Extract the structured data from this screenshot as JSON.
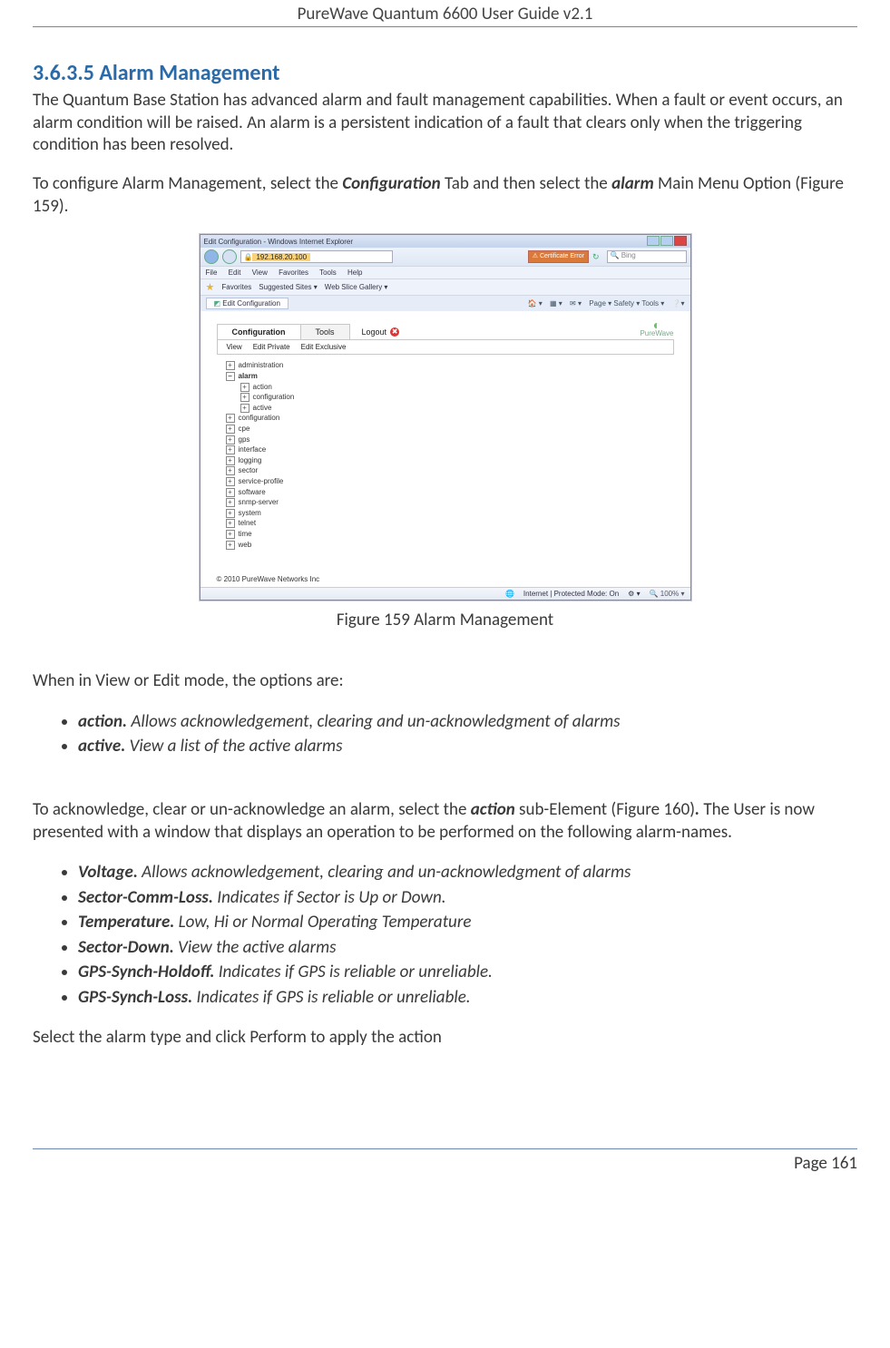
{
  "doc": {
    "header": "PureWave Quantum 6600 User Guide v2.1",
    "page_number": "Page 161"
  },
  "section": {
    "number": "3.6.3.5",
    "title": "Alarm Management"
  },
  "paragraphs": {
    "p1": "The Quantum Base Station has advanced alarm and fault management capabilities.  When a fault or event occurs, an alarm condition will be raised. An alarm is a persistent indication of a fault that clears only when the triggering condition has been resolved.",
    "p2_a": "To configure Alarm Management, select the ",
    "p2_conf": "Configuration",
    "p2_b": " Tab and then select the ",
    "p2_alarm": "alarm",
    "p2_c": " Main Menu Option (Figure 159).",
    "fig_caption": "Figure 159 Alarm Management",
    "p3": "When in View or Edit mode, the options are:",
    "p4_a": "To acknowledge, clear or un-acknowledge an alarm, select the ",
    "p4_action": "action",
    "p4_b": " sub-Element (Figure 160)",
    "p4_dot": ".",
    "p4_c": " The User is now presented with a window that displays an operation to be performed on the following alarm-names.",
    "p5": "Select the alarm type and click Perform to apply the action"
  },
  "list1": [
    {
      "term": "action.",
      "desc": "  Allows acknowledgement, clearing and un-acknowledgment of alarms"
    },
    {
      "term": "active.",
      "desc": "  View a list of the active alarms"
    }
  ],
  "list2": [
    {
      "term": "Voltage.",
      "desc": "  Allows acknowledgement, clearing and un-acknowledgment of alarms"
    },
    {
      "term": "Sector-Comm-Loss.",
      "desc": "  Indicates if Sector is Up or Down."
    },
    {
      "term": "Temperature.",
      "desc": "  Low, Hi or Normal Operating Temperature"
    },
    {
      "term": "Sector-Down.",
      "desc": "  View the active alarms"
    },
    {
      "term": "GPS-Synch-Holdoff.",
      "desc": "  Indicates if GPS is reliable or unreliable."
    },
    {
      "term": "GPS-Synch-Loss.",
      "desc": "  Indicates if GPS is reliable or unreliable."
    }
  ],
  "screenshot": {
    "window_title": "Edit Configuration - Windows Internet Explorer",
    "url_ip": "192.168.20.100",
    "cert_label": "Certificate Error",
    "search_placeholder": "Bing",
    "menubar": [
      "File",
      "Edit",
      "View",
      "Favorites",
      "Tools",
      "Help"
    ],
    "favbar_label": "Favorites",
    "favbar_suggested": "Suggested Sites ▾",
    "favbar_slice": "Web Slice Gallery ▾",
    "page_tab": "Edit Configuration",
    "toolbar_items": "Page ▾  Safety ▾  Tools ▾",
    "app_tabs": {
      "configuration": "Configuration",
      "tools": "Tools"
    },
    "logout": "Logout",
    "brand": "PureWave",
    "subtabs": [
      "View",
      "Edit Private",
      "Edit Exclusive"
    ],
    "tree": {
      "root": "administration",
      "alarm": "alarm",
      "alarm_children": [
        "action",
        "configuration",
        "active"
      ],
      "others": [
        "configuration",
        "cpe",
        "gps",
        "interface",
        "logging",
        "sector",
        "service-profile",
        "software",
        "snmp-server",
        "system",
        "telnet",
        "time",
        "web"
      ]
    },
    "copyright": "© 2010 PureWave Networks Inc",
    "status_text": "Internet | Protected Mode: On",
    "zoom": "100%"
  }
}
